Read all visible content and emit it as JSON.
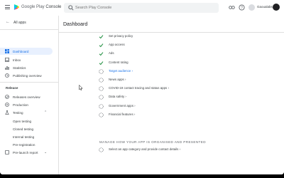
{
  "header": {
    "brand_prefix": "Google Play",
    "brand_product": "Console",
    "search_placeholder": "Search Play Console",
    "developer_name": "Gaoualabs"
  },
  "sidebar": {
    "all_apps": "All apps",
    "items": [
      {
        "label": "Dashboard",
        "icon": "dashboard-icon",
        "active": true
      },
      {
        "label": "Inbox",
        "icon": "inbox-icon",
        "active": false
      },
      {
        "label": "Statistics",
        "icon": "statistics-icon",
        "active": false
      },
      {
        "label": "Publishing overview",
        "icon": "publishing-icon",
        "active": false
      }
    ],
    "release_label": "Release",
    "release_items": [
      {
        "label": "Releases overview",
        "icon": "releases-icon"
      },
      {
        "label": "Production",
        "icon": "production-icon"
      },
      {
        "label": "Testing",
        "icon": "testing-icon"
      }
    ],
    "testing_subitems": [
      "Open testing",
      "Closed testing",
      "Internal testing",
      "Pre-registration"
    ],
    "prelaunch": {
      "label": "Pre-launch report",
      "icon": "prelaunch-icon"
    }
  },
  "main": {
    "title": "Dashboard",
    "tasks": [
      {
        "label": "Set privacy policy",
        "state": "done"
      },
      {
        "label": "App access",
        "state": "done"
      },
      {
        "label": "Ads",
        "state": "done"
      },
      {
        "label": "Content rating",
        "state": "done"
      },
      {
        "label": "Target audience ›",
        "state": "pending",
        "link": true
      },
      {
        "label": "News apps ›",
        "state": "pending"
      },
      {
        "label": "COVID-19 contact tracing and status apps ›",
        "state": "pending"
      },
      {
        "label": "Data safety ›",
        "state": "pending"
      },
      {
        "label": "Government apps ›",
        "state": "pending"
      },
      {
        "label": "Financial features ›",
        "state": "pending"
      }
    ],
    "section_title": "MANAGE HOW YOUR APP IS ORGANISED AND PRESENTED",
    "section_tasks": [
      {
        "label": "Select an app category and provide contact details ›",
        "state": "pending"
      }
    ]
  },
  "colors": {
    "accent": "#1a73e8",
    "active_bg": "#e8f0fe",
    "check": "#1e8e3e",
    "text": "#3c4043"
  }
}
